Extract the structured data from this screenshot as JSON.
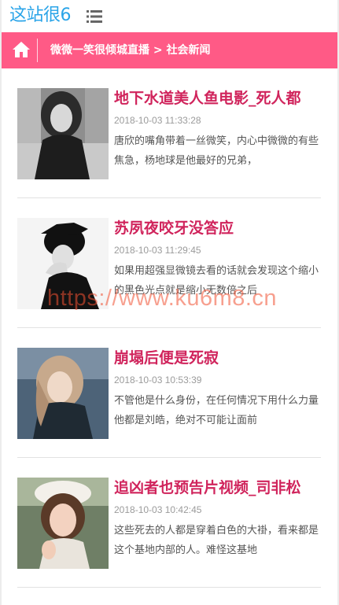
{
  "header": {
    "logo": "这站很6",
    "menu_icon": "menu-icon"
  },
  "breadcrumb": {
    "home_icon": "home-icon",
    "text": "微微一笑很倾城直播 > 社会新闻"
  },
  "articles": [
    {
      "title": "地下水道美人鱼电影_死人都",
      "time": "2018-10-03 11:33:28",
      "desc": "唐欣的嘴角带着一丝微笑，内心中微微的有些焦急，杨地球是他最好的兄弟，"
    },
    {
      "title": "苏夙夜咬牙没答应",
      "time": "2018-10-03 11:29:45",
      "desc": "如果用超强显微镜去看的话就会发现这个缩小的黑色光点就是缩小无数倍之后"
    },
    {
      "title": "崩塌后便是死寂",
      "time": "2018-10-03 10:53:39",
      "desc": "不管他是什么身份，在任何情况下用什么力量他都是刘皓，绝对不可能让面前"
    },
    {
      "title": "追凶者也预告片视频_司非松",
      "time": "2018-10-03 10:42:45",
      "desc": "这些死去的人都是穿着白色的大褂，看来都是这个基地内部的人。难怪这基地"
    }
  ],
  "watermark": "https://www.ku6m8.cn",
  "colors": {
    "accent": "#ff5a86",
    "title": "#d0245c",
    "logo": "#2aa4e8"
  }
}
